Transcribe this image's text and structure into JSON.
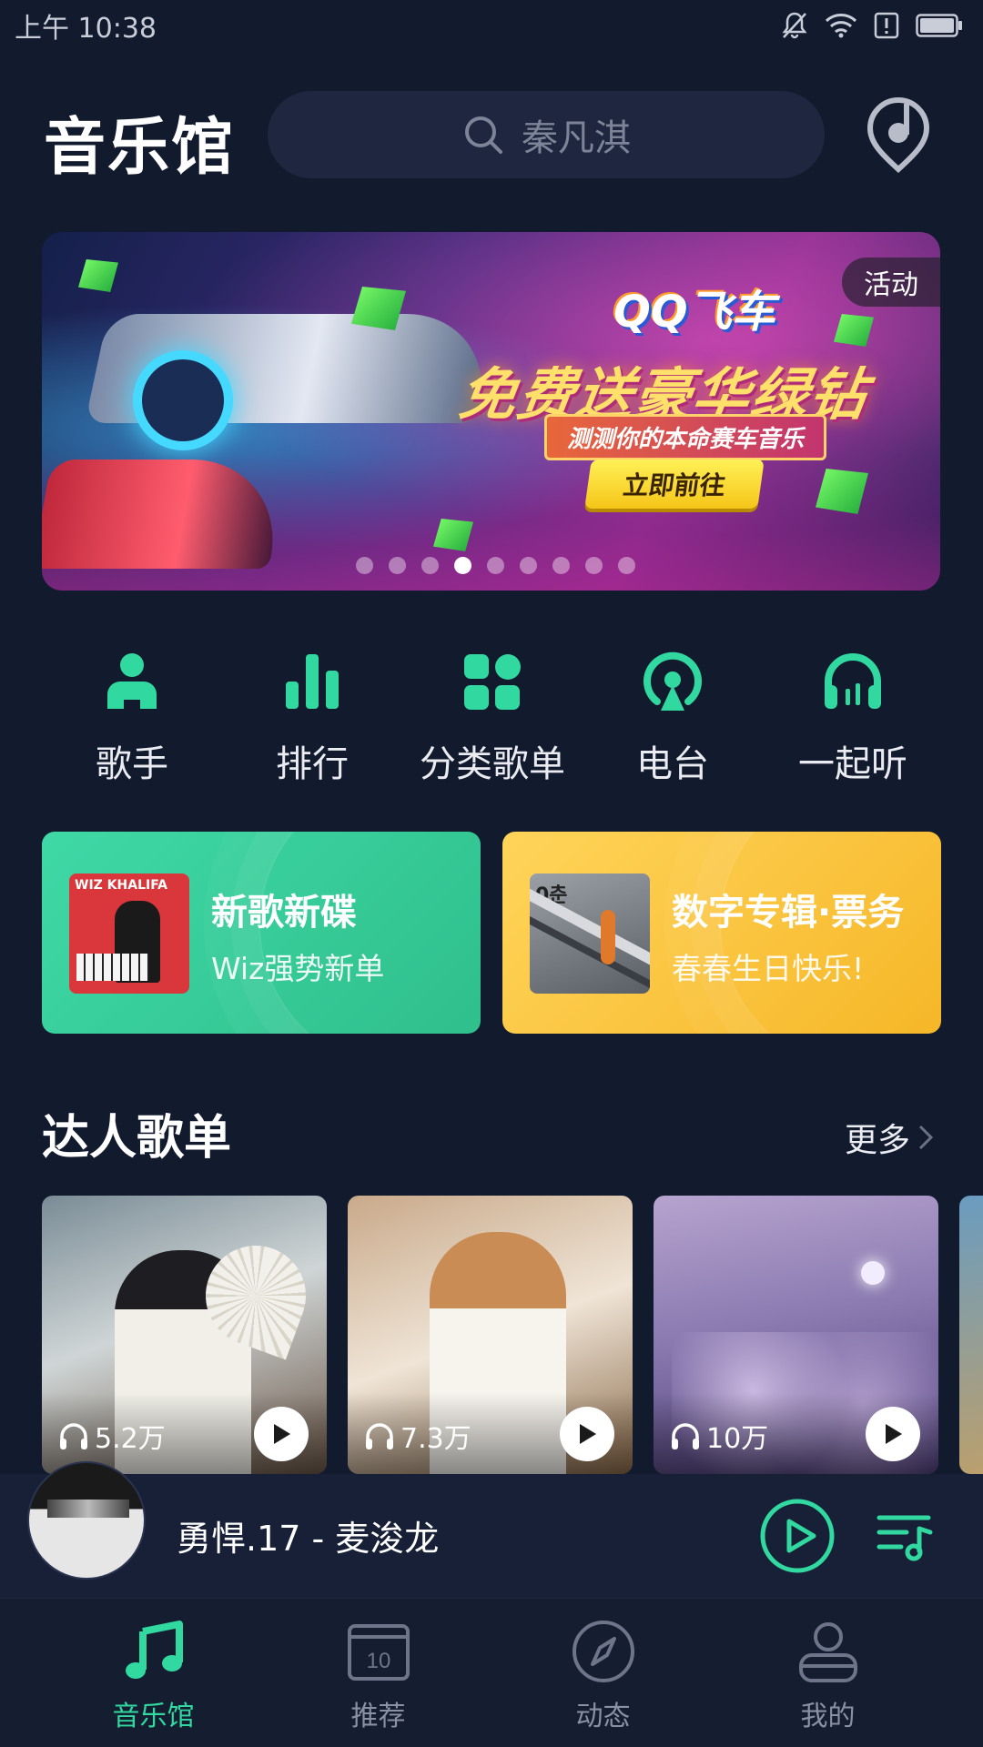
{
  "status_bar": {
    "time": "上午 10:38"
  },
  "header": {
    "title": "音乐馆",
    "search_placeholder": "秦凡淇"
  },
  "banner": {
    "logo": "QQ飞车",
    "headline": "免费送豪华绿钻",
    "sub": "测测你的本命赛车音乐",
    "cta": "立即前往",
    "badge": "活动",
    "dot_count": 9,
    "active_dot": 4
  },
  "categories": [
    {
      "label": "歌手",
      "icon": "singer-icon"
    },
    {
      "label": "排行",
      "icon": "chart-bars-icon"
    },
    {
      "label": "分类歌单",
      "icon": "grid-icon"
    },
    {
      "label": "电台",
      "icon": "radio-icon"
    },
    {
      "label": "一起听",
      "icon": "headphones-icon"
    }
  ],
  "promos": [
    {
      "title": "新歌新碟",
      "subtitle": "Wiz强势新单",
      "cover_text": "WIZ KHALIFA",
      "color": "#3fd9a6"
    },
    {
      "title": "数字专辑·票务",
      "subtitle": "春春生日快乐!",
      "cover_text": "0춘",
      "color": "#ffd45a"
    }
  ],
  "section": {
    "title": "达人歌单",
    "more": "更多"
  },
  "playlists": [
    {
      "plays": "5.2万"
    },
    {
      "plays": "7.3万"
    },
    {
      "plays": "10万"
    }
  ],
  "player": {
    "now_playing": "勇悍.17 - 麦浚龙"
  },
  "tabs": [
    {
      "label": "音乐馆",
      "icon": "music-note-icon",
      "active": true
    },
    {
      "label": "推荐",
      "icon": "calendar-icon",
      "active": false,
      "icon_text": "10"
    },
    {
      "label": "动态",
      "icon": "compass-icon",
      "active": false
    },
    {
      "label": "我的",
      "icon": "person-icon",
      "active": false
    }
  ],
  "colors": {
    "accent": "#31d8a0",
    "background": "#121a2e"
  }
}
